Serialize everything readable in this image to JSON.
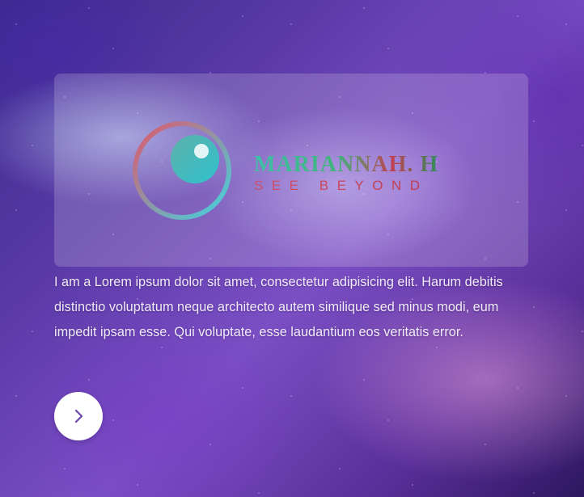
{
  "brand": {
    "name": "MARIANNAH. H",
    "tagline": "SEE BEYOND",
    "colors": {
      "ring_start": "#e0566a",
      "ring_end": "#3fd6e0",
      "name_primary": "#3fb37a",
      "tagline": "#c03a4c"
    }
  },
  "hero": {
    "description": "I am a Lorem ipsum dolor sit amet, consectetur adipisicing elit. Harum debitis distinctio voluptatum neque architecto autem similique sed minus modi, eum impedit ipsam esse. Qui voluptate, esse laudantium eos veritatis error."
  },
  "next_button": {
    "icon": "chevron-right-icon",
    "icon_color": "#6b4aa8"
  }
}
